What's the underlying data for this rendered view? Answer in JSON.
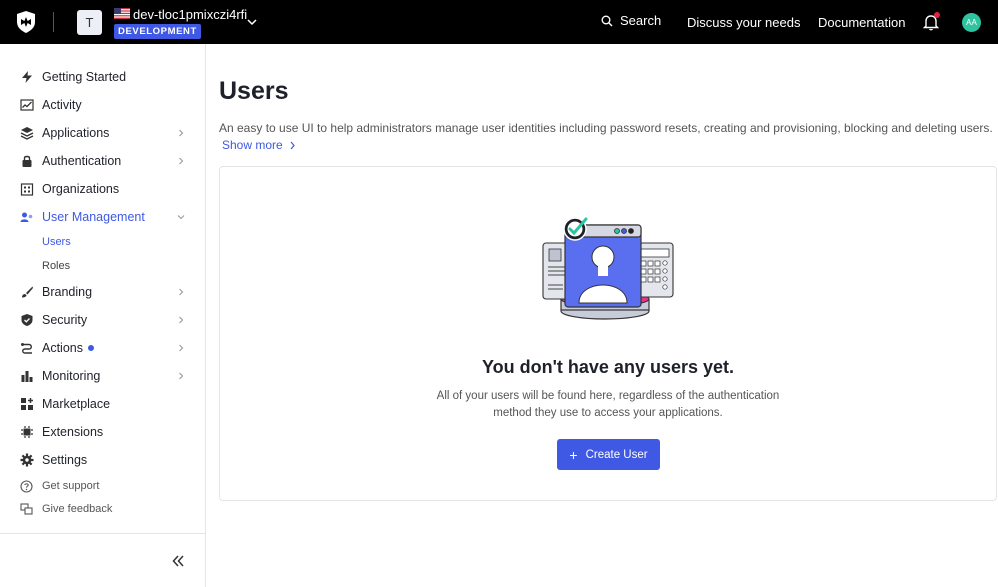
{
  "topbar": {
    "tenant_initial": "T",
    "tenant_name": "dev-tloc1pmixczi4rfi",
    "environment": "DEVELOPMENT",
    "search_label": "Search",
    "discuss_label": "Discuss your needs",
    "docs_label": "Documentation",
    "user_initials": "AA",
    "avatar_color": "#2ec4a0",
    "accent": "#3f59e4"
  },
  "sidebar": {
    "items": [
      {
        "label": "Getting Started",
        "icon": "lightning-icon"
      },
      {
        "label": "Activity",
        "icon": "activity-chart-icon"
      },
      {
        "label": "Applications",
        "icon": "layers-icon"
      },
      {
        "label": "Authentication",
        "icon": "lock-icon"
      },
      {
        "label": "Organizations",
        "icon": "building-icon"
      },
      {
        "label": "User Management",
        "icon": "users-icon"
      },
      {
        "label": "Branding",
        "icon": "brush-icon"
      },
      {
        "label": "Security",
        "icon": "shield-icon"
      },
      {
        "label": "Actions",
        "icon": "flow-icon"
      },
      {
        "label": "Monitoring",
        "icon": "bar-chart-icon"
      },
      {
        "label": "Marketplace",
        "icon": "grid-plus-icon"
      },
      {
        "label": "Extensions",
        "icon": "chip-icon"
      },
      {
        "label": "Settings",
        "icon": "gear-icon"
      }
    ],
    "sub_items": [
      "Users",
      "Roles"
    ],
    "support": "Get support",
    "feedback": "Give feedback"
  },
  "main": {
    "title": "Users",
    "description": "An easy to use UI to help administrators manage user identities including password resets, creating and provisioning, blocking and deleting users.",
    "show_more": "Show more",
    "empty_title": "You don't have any users yet.",
    "empty_desc": "All of your users will be found here, regardless of the authentication method they use to access your applications.",
    "create_button": "Create User"
  }
}
